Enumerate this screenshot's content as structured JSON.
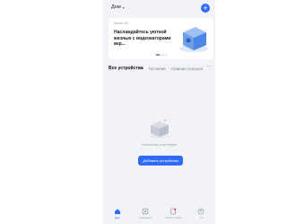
{
  "header": {
    "home_label": "Дом",
    "home_chevron": "▾",
    "add_symbol": "+"
  },
  "banner": {
    "tag": "Smart Life",
    "text": "Наслаждайтесь уютной жизнью с видеокаторами вкр...",
    "slide_count": 3,
    "active_slide": 1
  },
  "tabs": {
    "items": [
      "Все устройства",
      "Гостиная",
      "Главная спальня"
    ],
    "active_index": 0,
    "more_symbol": "···"
  },
  "empty_state": {
    "message": "Устройства отсутствуют",
    "button_label": "Добавить устройства"
  },
  "bottom_nav": {
    "items": [
      {
        "label": "Дом",
        "icon": "home-icon",
        "active": true
      },
      {
        "label": "Сценарий",
        "icon": "scene-icon",
        "active": false
      },
      {
        "label": "Smart Center",
        "icon": "smart-icon",
        "active": false
      },
      {
        "label": "Я",
        "icon": "profile-icon",
        "active": false
      }
    ]
  },
  "colors": {
    "accent": "#2f6cf6",
    "background": "#f2f3f6"
  }
}
